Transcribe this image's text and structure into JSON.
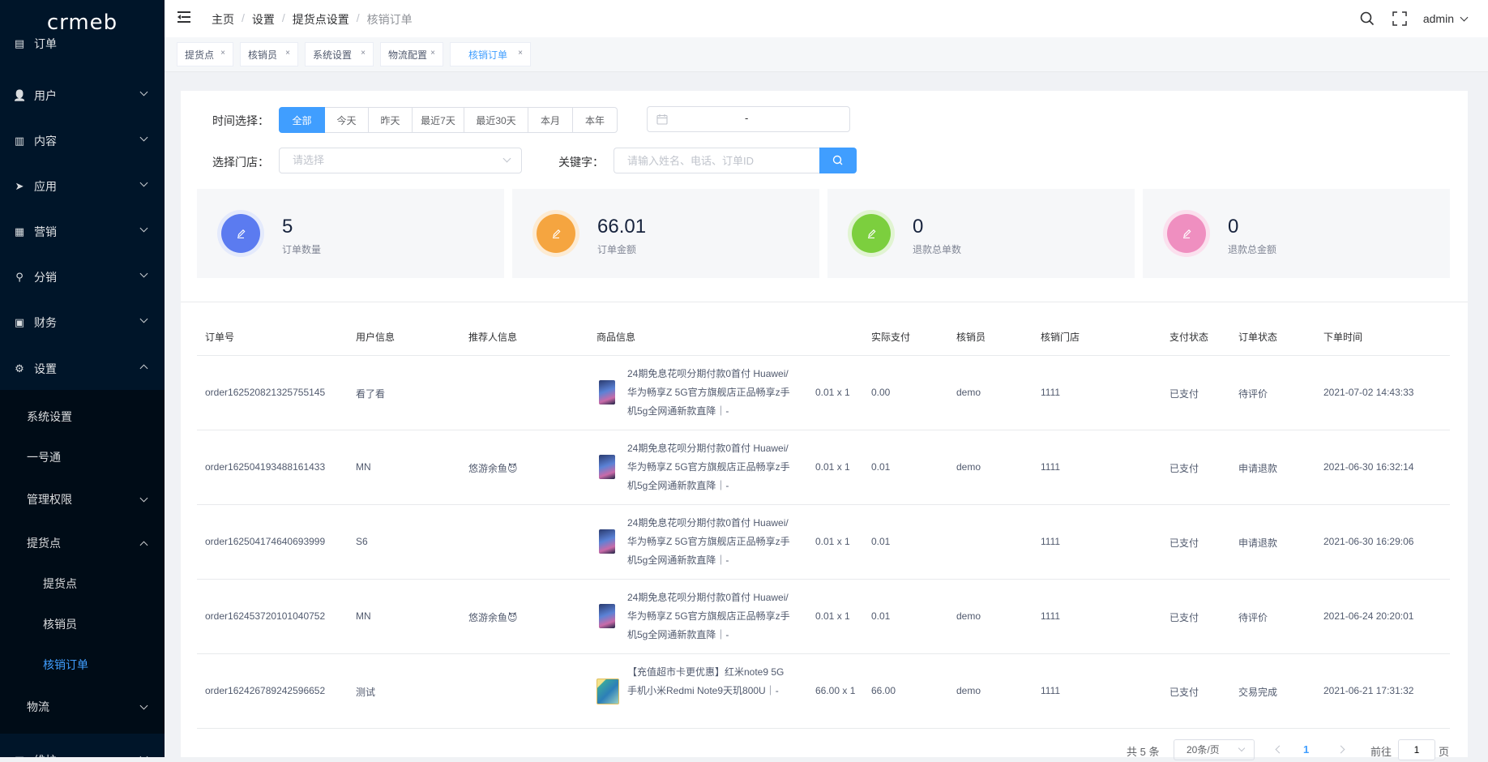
{
  "logo": {
    "text": "crmeb"
  },
  "sidebar": {
    "top_partial": {
      "label": "订单",
      "icon": "order-icon"
    },
    "groups": [
      {
        "label": "用户",
        "icon": "user-icon"
      },
      {
        "label": "内容",
        "icon": "content-icon"
      },
      {
        "label": "应用",
        "icon": "paper-plane-icon"
      },
      {
        "label": "营销",
        "icon": "chart-icon"
      },
      {
        "label": "分销",
        "icon": "distribution-icon"
      },
      {
        "label": "财务",
        "icon": "wallet-icon"
      },
      {
        "label": "设置",
        "icon": "gear-icon"
      }
    ],
    "settings_children": [
      {
        "label": "系统设置"
      },
      {
        "label": "一号通"
      },
      {
        "label": "管理权限"
      },
      {
        "label": "提货点"
      },
      {
        "label": "提货点"
      },
      {
        "label": "核销员"
      },
      {
        "label": "核销订单"
      },
      {
        "label": "物流"
      }
    ],
    "bottom_partial": {
      "label": "维护",
      "icon": "maintain-icon"
    }
  },
  "header": {
    "breadcrumb": [
      "主页",
      "设置",
      "提货点设置",
      "核销订单"
    ],
    "breadcrumb_sep": "/",
    "user": "admin"
  },
  "tags": [
    {
      "label": "提货点"
    },
    {
      "label": "核销员"
    },
    {
      "label": "系统设置"
    },
    {
      "label": "物流配置"
    },
    {
      "label": "核销订单",
      "active": true
    }
  ],
  "tag_close": "×",
  "filters": {
    "time_label": "时间选择：",
    "time_options": [
      "全部",
      "今天",
      "昨天",
      "最近7天",
      "最近30天",
      "本月",
      "本年"
    ],
    "time_selected": "全部",
    "date_range_sep": "-",
    "store_label": "选择门店：",
    "store_placeholder": "请选择",
    "keyword_label": "关键字：",
    "keyword_placeholder": "请输入姓名、电话、订单ID"
  },
  "stats": [
    {
      "value": "5",
      "label": "订单数量",
      "color": "#5b7bf0",
      "ring": "#e4eafc"
    },
    {
      "value": "66.01",
      "label": "订单金额",
      "color": "#f5a540",
      "ring": "#fdebd3"
    },
    {
      "value": "0",
      "label": "退款总单数",
      "color": "#7ccf3e",
      "ring": "#e1f4d2"
    },
    {
      "value": "0",
      "label": "退款总金额",
      "color": "#ef8fc0",
      "ring": "#fbe0ee"
    }
  ],
  "table": {
    "columns": [
      "订单号",
      "用户信息",
      "推荐人信息",
      "商品信息",
      "实际支付",
      "核销员",
      "核销门店",
      "支付状态",
      "订单状态",
      "下单时间"
    ],
    "rows": [
      {
        "order_no": "order162520821325755145",
        "user": "看了看",
        "referrer": "",
        "product": "24期免息花呗分期付款0首付 Huawei/华为畅享Z 5G官方旗舰店正品畅享z手机5g全网通新款直降｜-",
        "qty": "0.01 x 1",
        "paid": "0.00",
        "clerk": "demo",
        "store": "1111",
        "pay_status": "已支付",
        "order_status": "待评价",
        "time": "2021-07-02 14:43:33",
        "img": "phone"
      },
      {
        "order_no": "order162504193488161433",
        "user": "MN",
        "referrer": "悠游余鱼😈",
        "product": "24期免息花呗分期付款0首付 Huawei/华为畅享Z 5G官方旗舰店正品畅享z手机5g全网通新款直降｜-",
        "qty": "0.01 x 1",
        "paid": "0.01",
        "clerk": "demo",
        "store": "1111",
        "pay_status": "已支付",
        "order_status": "申请退款",
        "time": "2021-06-30 16:32:14",
        "img": "phone"
      },
      {
        "order_no": "order162504174640693999",
        "user": "S6",
        "referrer": "",
        "product": "24期免息花呗分期付款0首付 Huawei/华为畅享Z 5G官方旗舰店正品畅享z手机5g全网通新款直降｜-",
        "qty": "0.01 x 1",
        "paid": "0.01",
        "clerk": "",
        "store": "1111",
        "pay_status": "已支付",
        "order_status": "申请退款",
        "time": "2021-06-30 16:29:06",
        "img": "phone"
      },
      {
        "order_no": "order162453720101040752",
        "user": "MN",
        "referrer": "悠游余鱼😈",
        "product": "24期免息花呗分期付款0首付 Huawei/华为畅享Z 5G官方旗舰店正品畅享z手机5g全网通新款直降｜-",
        "qty": "0.01 x 1",
        "paid": "0.01",
        "clerk": "demo",
        "store": "1111",
        "pay_status": "已支付",
        "order_status": "待评价",
        "time": "2021-06-24 20:20:01",
        "img": "phone"
      },
      {
        "order_no": "order162426789242596652",
        "user": "测试",
        "referrer": "",
        "product": "【充值超市卡更优惠】红米note9 5G手机小米Redmi Note9天玑800U｜-",
        "qty": "66.00 x 1",
        "paid": "66.00",
        "clerk": "demo",
        "store": "1111",
        "pay_status": "已支付",
        "order_status": "交易完成",
        "time": "2021-06-21 17:31:32",
        "img": "redmi"
      }
    ]
  },
  "pagination": {
    "total": "共 5 条",
    "page_size": "20条/页",
    "current_page": "1",
    "goto_label": "前往",
    "goto_value": "1",
    "page_unit": "页"
  }
}
